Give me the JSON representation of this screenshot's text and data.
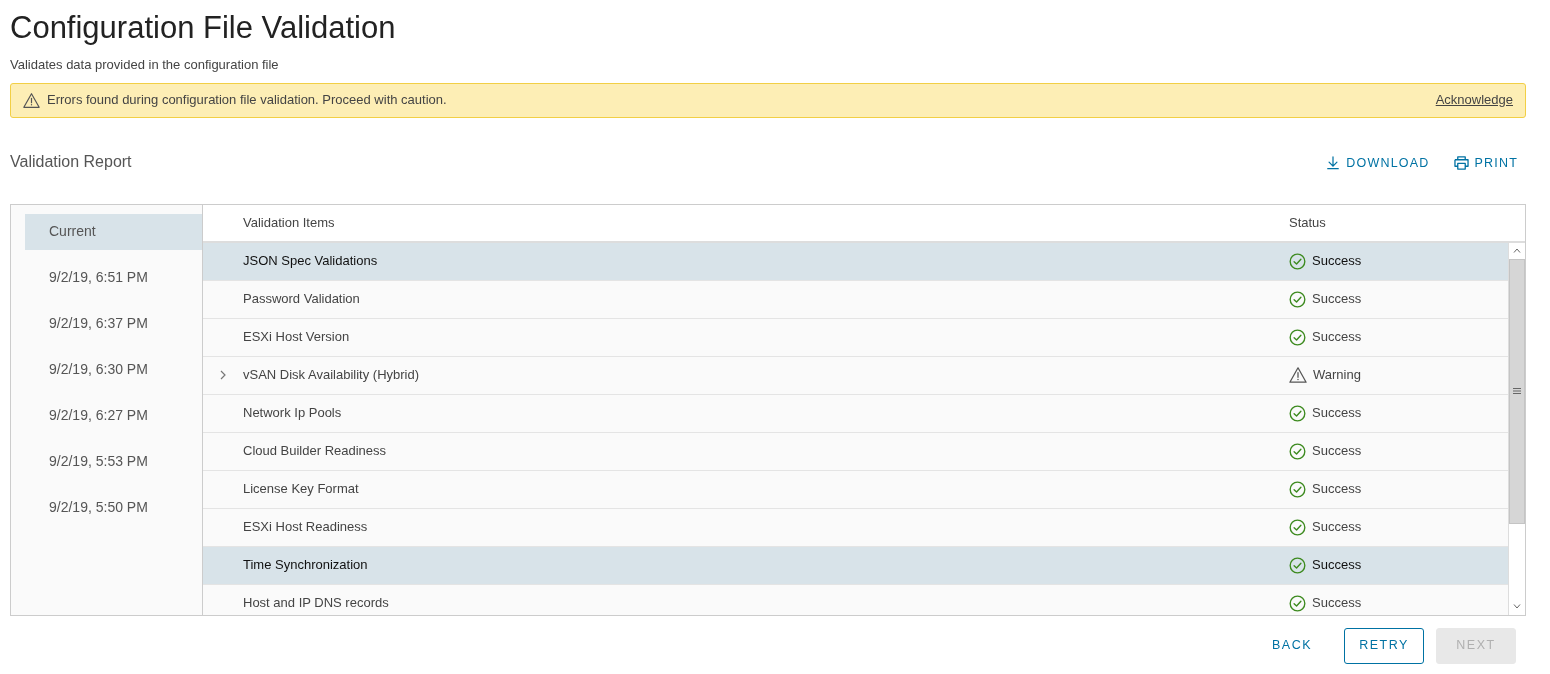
{
  "page": {
    "title": "Configuration File Validation",
    "subtitle": "Validates data provided in the configuration file"
  },
  "alert": {
    "message": "Errors found during configuration file validation. Proceed with caution.",
    "action": "Acknowledge"
  },
  "report": {
    "title": "Validation Report",
    "actions": [
      {
        "label": "DOWNLOAD",
        "kind": "download"
      },
      {
        "label": "PRINT",
        "kind": "print"
      }
    ]
  },
  "history": [
    {
      "label": "Current",
      "selected": true
    },
    {
      "label": "9/2/19, 6:51 PM",
      "selected": false
    },
    {
      "label": "9/2/19, 6:37 PM",
      "selected": false
    },
    {
      "label": "9/2/19, 6:30 PM",
      "selected": false
    },
    {
      "label": "9/2/19, 6:27 PM",
      "selected": false
    },
    {
      "label": "9/2/19, 5:53 PM",
      "selected": false
    },
    {
      "label": "9/2/19, 5:50 PM",
      "selected": false
    }
  ],
  "table": {
    "columns": [
      "Validation Items",
      "Status"
    ],
    "rows": [
      {
        "item": "JSON Spec Validations",
        "status": "Success",
        "kind": "success",
        "selected": true,
        "expandable": false
      },
      {
        "item": "Password Validation",
        "status": "Success",
        "kind": "success",
        "selected": false,
        "expandable": false
      },
      {
        "item": "ESXi Host Version",
        "status": "Success",
        "kind": "success",
        "selected": false,
        "expandable": false
      },
      {
        "item": "vSAN Disk Availability (Hybrid)",
        "status": "Warning",
        "kind": "warning",
        "selected": false,
        "expandable": true
      },
      {
        "item": "Network Ip Pools",
        "status": "Success",
        "kind": "success",
        "selected": false,
        "expandable": false
      },
      {
        "item": "Cloud Builder Readiness",
        "status": "Success",
        "kind": "success",
        "selected": false,
        "expandable": false
      },
      {
        "item": "License Key Format",
        "status": "Success",
        "kind": "success",
        "selected": false,
        "expandable": false
      },
      {
        "item": "ESXi Host Readiness",
        "status": "Success",
        "kind": "success",
        "selected": false,
        "expandable": false
      },
      {
        "item": "Time Synchronization",
        "status": "Success",
        "kind": "success",
        "selected": true,
        "expandable": false
      },
      {
        "item": "Host and IP DNS records",
        "status": "Success",
        "kind": "success",
        "selected": false,
        "expandable": false
      }
    ]
  },
  "footer": {
    "buttons": [
      {
        "label": "BACK",
        "kind": "flat",
        "disabled": false
      },
      {
        "label": "RETRY",
        "kind": "outline",
        "disabled": false
      },
      {
        "label": "NEXT",
        "kind": "solid",
        "disabled": true
      }
    ]
  }
}
